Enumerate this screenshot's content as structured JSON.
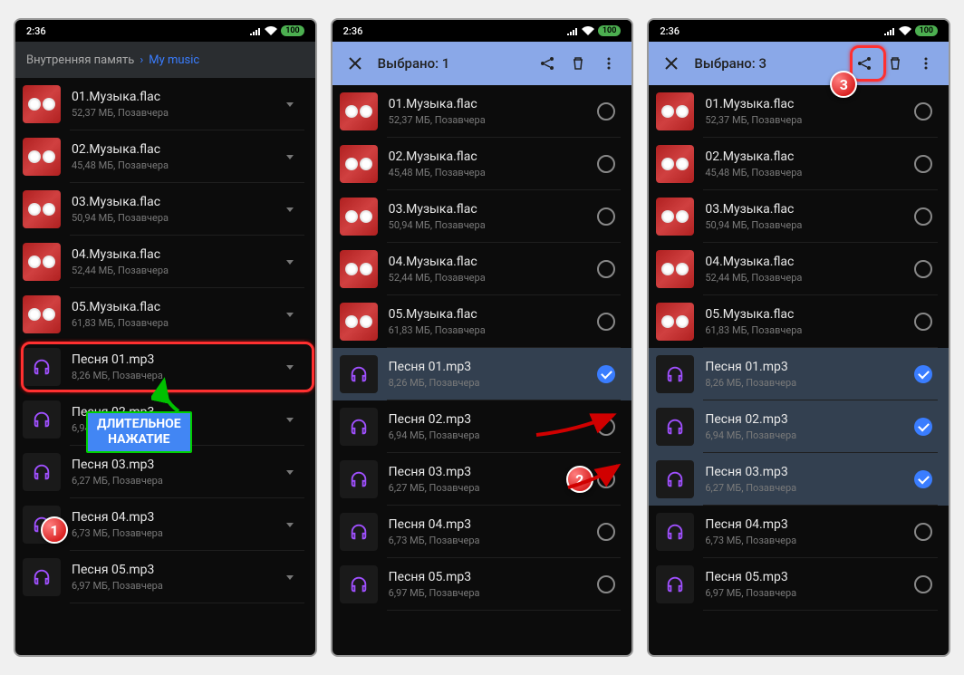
{
  "status": {
    "time": "2:36",
    "battery": "100"
  },
  "breadcrumb": {
    "root": "Внутренняя память",
    "current": "My music"
  },
  "selection": {
    "label1": "Выбрано: 1",
    "label3": "Выбрано: 3"
  },
  "files": [
    {
      "name": "01.Музыка.flac",
      "size": "52,37 МБ",
      "date": "Позавчера",
      "type": "album"
    },
    {
      "name": "02.Музыка.flac",
      "size": "45,48 МБ",
      "date": "Позавчера",
      "type": "album"
    },
    {
      "name": "03.Музыка.flac",
      "size": "50,94 МБ",
      "date": "Позавчера",
      "type": "album"
    },
    {
      "name": "04.Музыка.flac",
      "size": "52,44 МБ",
      "date": "Позавчера",
      "type": "album"
    },
    {
      "name": "05.Музыка.flac",
      "size": "61,83 МБ",
      "date": "Позавчера",
      "type": "album"
    },
    {
      "name": "Песня 01.mp3",
      "size": "8,26 МБ",
      "date": "Позавчера",
      "type": "mp3"
    },
    {
      "name": "Песня 02.mp3",
      "size": "6,94 МБ",
      "date": "Позавчера",
      "type": "mp3"
    },
    {
      "name": "Песня 03.mp3",
      "size": "6,27 МБ",
      "date": "Позавчера",
      "type": "mp3"
    },
    {
      "name": "Песня 04.mp3",
      "size": "6,73 МБ",
      "date": "Позавчера",
      "type": "mp3"
    },
    {
      "name": "Песня 05.mp3",
      "size": "6,97 МБ",
      "date": "Позавчера",
      "type": "mp3"
    }
  ],
  "annotations": {
    "long_press1": "ДЛИТЕЛЬНОЕ",
    "long_press2": "НАЖАТИЕ"
  }
}
